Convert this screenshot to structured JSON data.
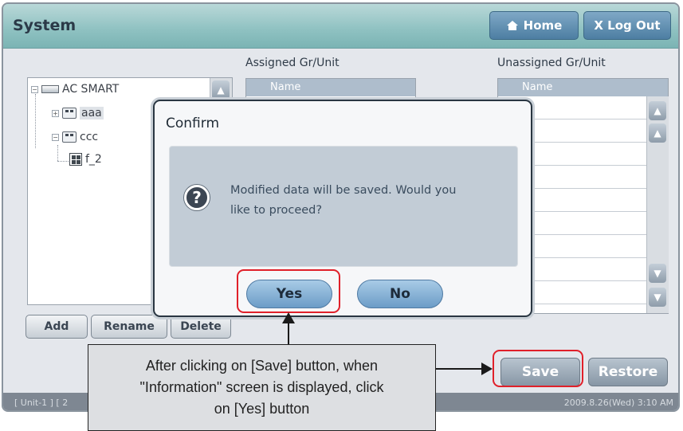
{
  "window": {
    "title": "System"
  },
  "header": {
    "home_label": "Home",
    "logout_label": "X Log Out"
  },
  "panels": {
    "assigned_title": "Assigned Gr/Unit",
    "unassigned_title": "Unassigned Gr/Unit",
    "column_name": "Name"
  },
  "tree": {
    "root": "AC SMART",
    "nodes": [
      {
        "label": "aaa"
      },
      {
        "label": "ccc"
      },
      {
        "label": "f_2"
      }
    ]
  },
  "tree_buttons": {
    "add": "Add",
    "rename": "Rename",
    "delete": "Delete"
  },
  "actions": {
    "save": "Save",
    "restore": "Restore"
  },
  "status": {
    "left": "[ Unit-1 ] [ 2",
    "right": "2009.8.26(Wed)  3:10 AM"
  },
  "dialog": {
    "title": "Confirm",
    "message_line1": "Modified data will be saved.  Would you",
    "message_line2": "like to proceed?",
    "yes": "Yes",
    "no": "No"
  },
  "annotation": {
    "line1": "After clicking on [Save] button, when",
    "line2": "\"Information\" screen is displayed, click",
    "line3": "on [Yes] button"
  },
  "colors": {
    "highlight": "#e0202a",
    "title_bar": "#8ec1c1",
    "dialog_body": "#c2ccd6"
  }
}
